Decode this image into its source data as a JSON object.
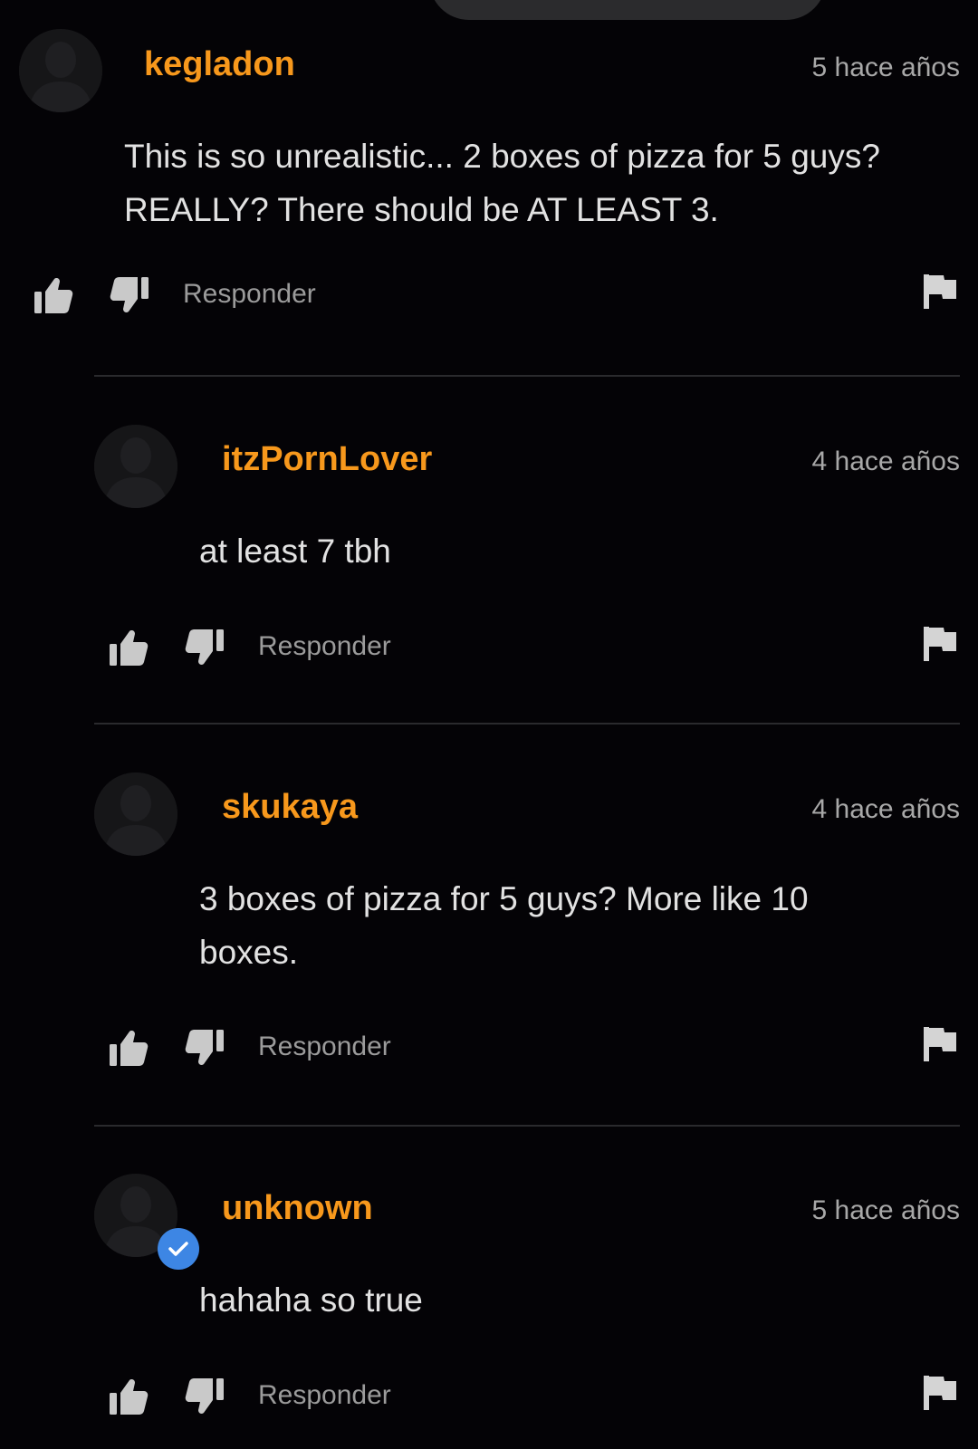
{
  "comments": [
    {
      "username": "kegladon",
      "time": "5 hace años",
      "text": "This is so unrealistic... 2 boxes of pizza for 5 guys? REALLY? There should be AT LEAST 3.",
      "reply_label": "Responder",
      "verified": false
    },
    {
      "username": "itzPornLover",
      "time": "4 hace años",
      "text": "at least 7 tbh",
      "reply_label": "Responder",
      "verified": false
    },
    {
      "username": "skukaya",
      "time": "4 hace años",
      "text": "3 boxes of pizza for 5 guys? More like 10 boxes.",
      "reply_label": "Responder",
      "verified": false
    },
    {
      "username": "unknown",
      "time": "5 hace años",
      "text": "hahaha so true",
      "reply_label": "Responder",
      "verified": true
    }
  ],
  "icons": {
    "like": "thumbs-up-icon",
    "dislike": "thumbs-down-icon",
    "flag": "flag-icon",
    "avatar": "user-silhouette-icon",
    "verified": "verified-check-icon"
  },
  "colors": {
    "background": "#040306",
    "username": "#f7981c",
    "verified_badge": "#3d86e4"
  }
}
